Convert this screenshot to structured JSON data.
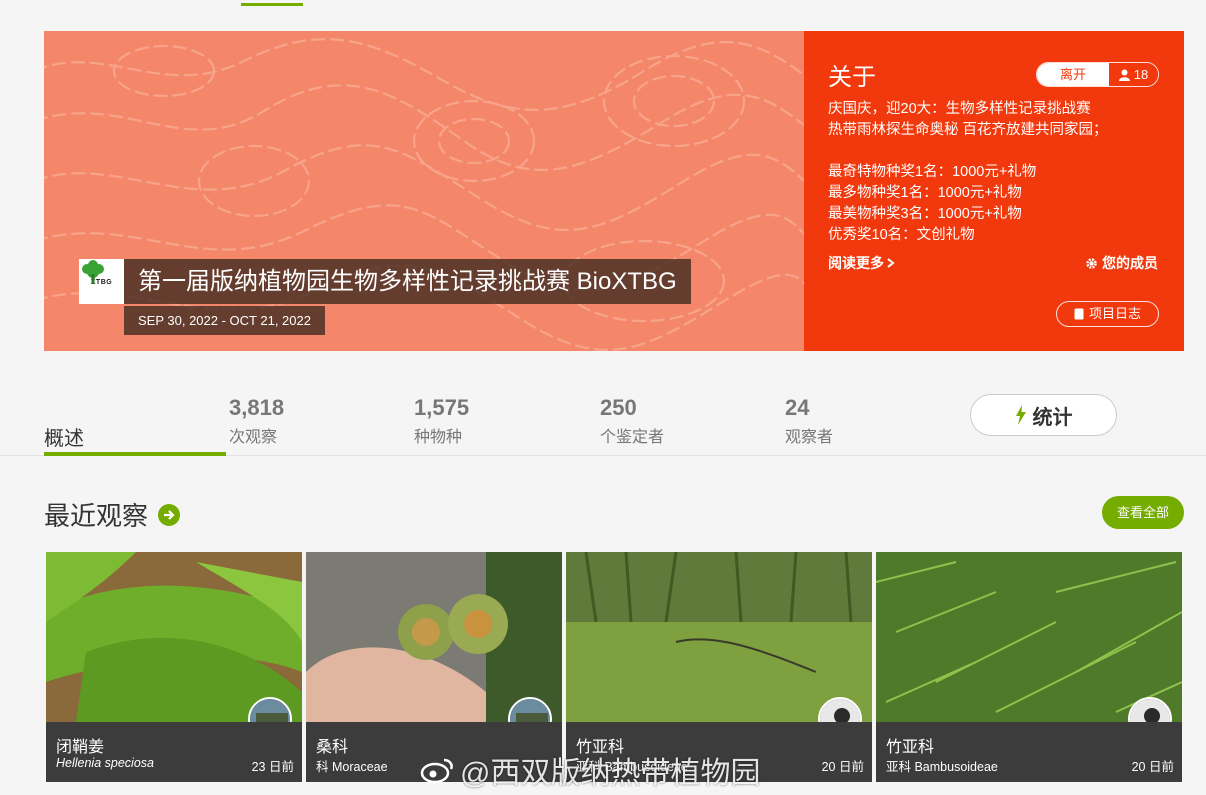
{
  "project": {
    "title": "第一届版纳植物园生物多样性记录挑战赛 BioXTBG",
    "dates": "SEP 30, 2022 - OCT 21, 2022",
    "logo_text": "XTBG"
  },
  "about": {
    "heading": "关于",
    "leave_label": "离开",
    "member_count": "18",
    "description": "庆国庆，迎20大：生物多样性记录挑战赛\n热带雨林探生命奥秘 百花齐放建共同家园；\n\n最奇特物种奖1名：1000元+礼物\n最多物种奖1名：1000元+礼物\n最美物种奖3名：1000元+礼物\n优秀奖10名：文创礼物",
    "read_more": "阅读更多",
    "your_members": "您的成员",
    "journal": "项目日志"
  },
  "stats": {
    "overview": "概述",
    "items": [
      {
        "num": "3,818",
        "label": "次观察"
      },
      {
        "num": "1,575",
        "label": "种物种"
      },
      {
        "num": "250",
        "label": "个鉴定者"
      },
      {
        "num": "24",
        "label": "观察者"
      }
    ],
    "button": "统计"
  },
  "recent": {
    "title": "最近观察",
    "view_all": "查看全部",
    "observations": [
      {
        "name": "闭鞘姜",
        "sci": "Hellenia speciosa",
        "time": "23 日前"
      },
      {
        "name": "桑科",
        "sci": "科 Moraceae",
        "time": ""
      },
      {
        "name": "竹亚科",
        "sci": "亚科 Bambusoideae",
        "time": "20 日前"
      },
      {
        "name": "竹亚科",
        "sci": "亚科 Bambusoideae",
        "time": "20 日前"
      }
    ]
  },
  "watermark": "@西双版纳热带植物园",
  "colors": {
    "accent": "#74ac00",
    "about_bg": "#f2380d",
    "banner_bg": "#f4876a"
  }
}
